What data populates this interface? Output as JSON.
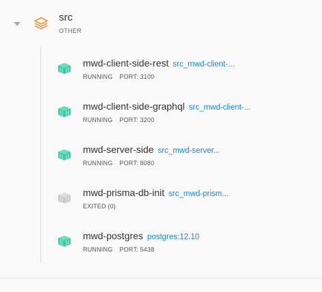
{
  "group": {
    "name": "src",
    "subtitle": "OTHER",
    "icon": "stack-layers-icon",
    "icon_color": "#e8923b"
  },
  "containers": [
    {
      "name": "mwd-client-side-rest",
      "image": "src_mwd-client-...",
      "status": "RUNNING",
      "port": "PORT: 3100",
      "icon": "container-cube-icon",
      "icon_color": "#3ec8a5"
    },
    {
      "name": "mwd-client-side-graphql",
      "image": "src_mwd-client-...",
      "status": "RUNNING",
      "port": "PORT: 3200",
      "icon": "container-cube-icon",
      "icon_color": "#3ec8a5"
    },
    {
      "name": "mwd-server-side",
      "image": "src_mwd-server...",
      "status": "RUNNING",
      "port": "PORT: 8080",
      "icon": "container-cube-icon",
      "icon_color": "#3ec8a5"
    },
    {
      "name": "mwd-prisma-db-init",
      "image": "src_mwd-prism...",
      "status": "EXITED (0)",
      "port": "",
      "icon": "container-cube-icon",
      "icon_color": "#c8c8c8"
    },
    {
      "name": "mwd-postgres",
      "image": "postgres:12.10",
      "status": "RUNNING",
      "port": "PORT: 5438",
      "icon": "container-cube-icon",
      "icon_color": "#3ec8a5"
    }
  ],
  "colors": {
    "running": "#3ec8a5",
    "exited": "#c8c8c8",
    "link": "#1a86c8"
  }
}
